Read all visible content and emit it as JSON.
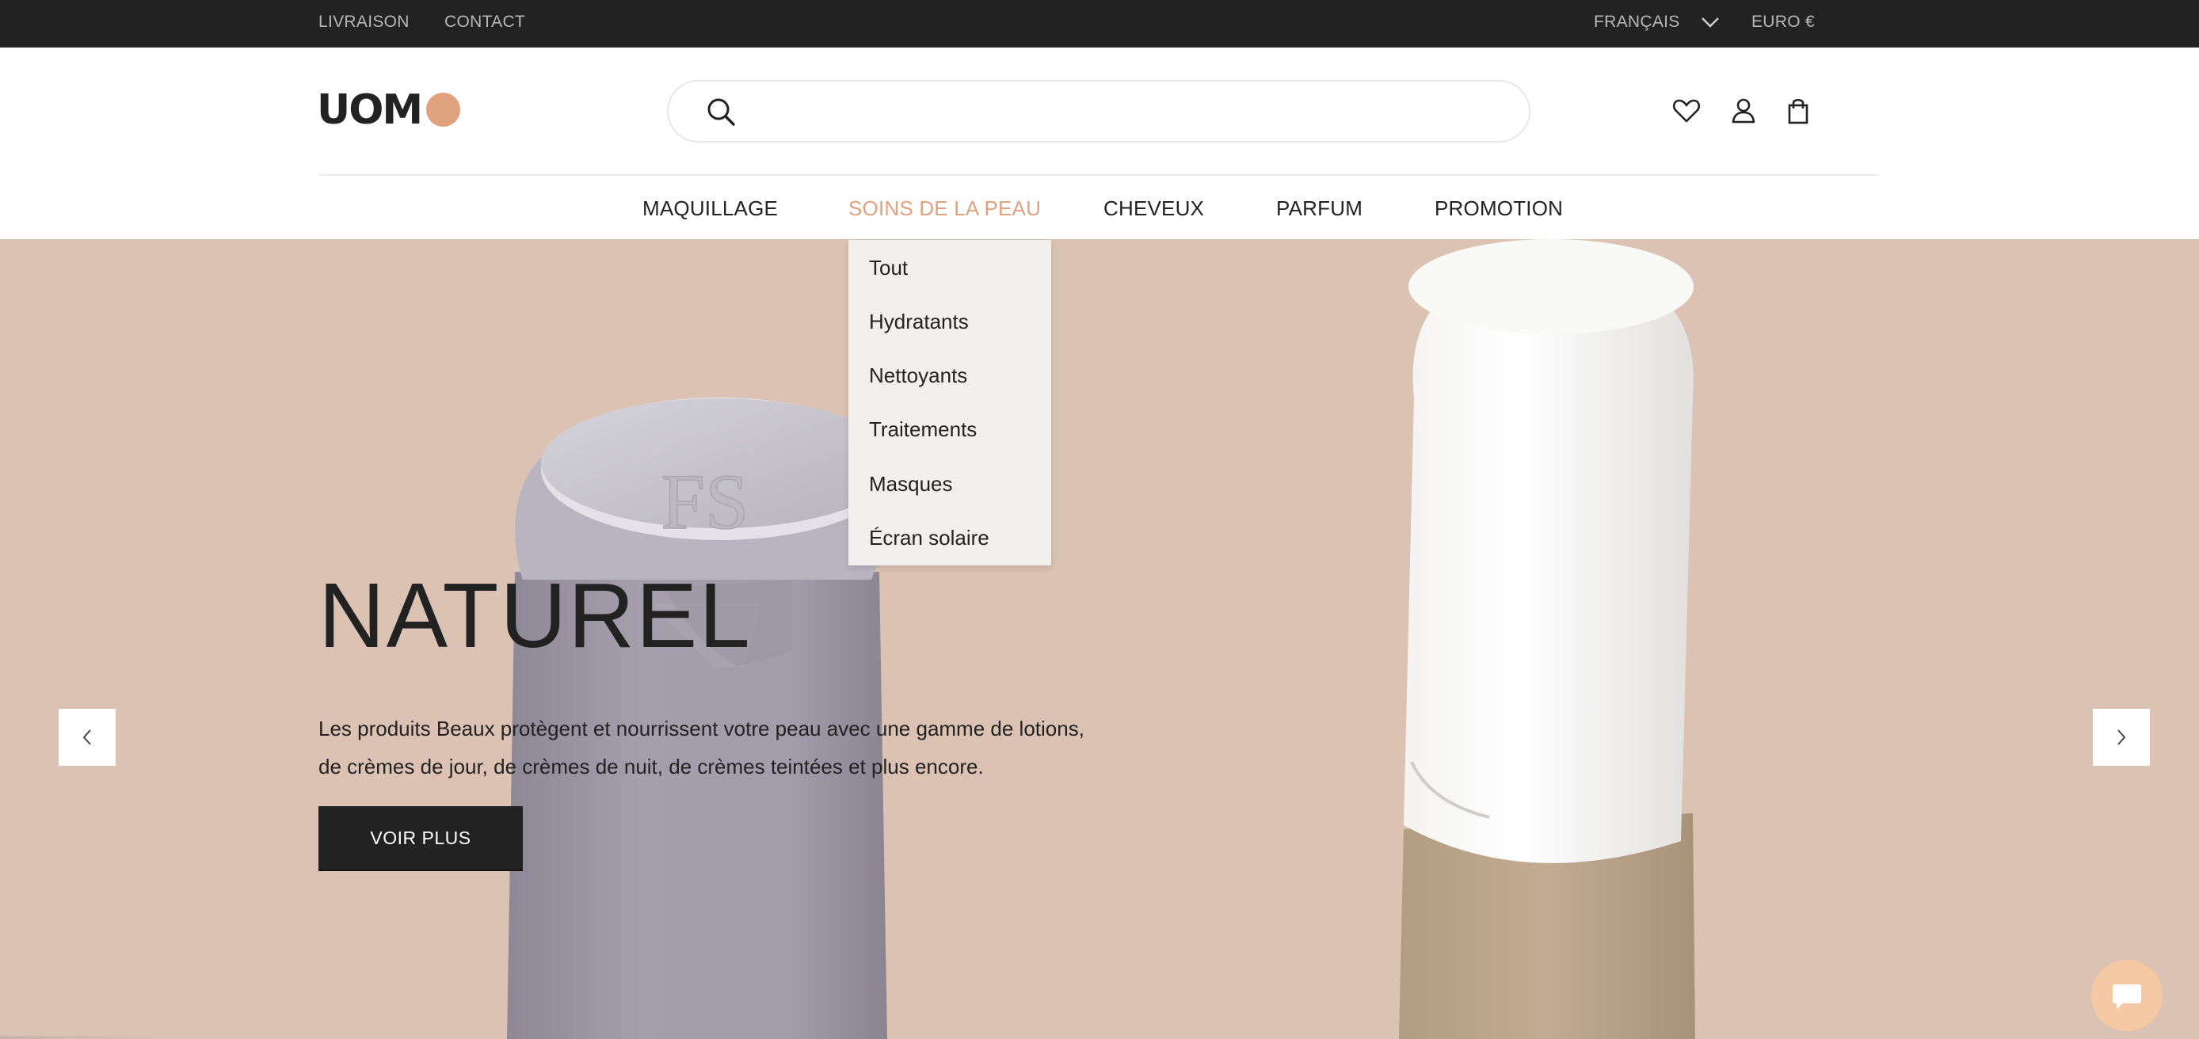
{
  "topbar": {
    "livraison": "LIVRAISON",
    "contact": "CONTACT",
    "language": "FRANÇAIS",
    "currency": "EURO €"
  },
  "header": {
    "logo_text": "UOM",
    "search": {
      "placeholder": "",
      "value": ""
    },
    "icons": [
      "heart-icon",
      "user-icon",
      "shopping-bag-icon",
      "search-icon"
    ]
  },
  "nav": {
    "items": [
      "MAQUILLAGE",
      "SOINS DE LA PEAU",
      "CHEVEUX",
      "PARFUM",
      "PROMOTION"
    ],
    "active_index": 1
  },
  "dropdown": {
    "items": [
      "Tout",
      "Hydratants",
      "Nettoyants",
      "Traitements",
      "Masques",
      "Écran solaire"
    ]
  },
  "hero": {
    "title": "NATUREL",
    "text_line1": "Les produits Beaux protègent et nourrissent votre peau avec une gamme de lotions,",
    "text_line2": "de crèmes de jour, de crèmes de nuit, de crèmes teintées et plus encore.",
    "button_label": "VOIR PLUS",
    "bottle_mark": "FS"
  },
  "colors": {
    "accent": "#e0a17e",
    "topbar_bg": "#222222",
    "hero_bg": "#dbc2b2",
    "dropdown_bg": "#f1f0ef",
    "chat_bg": "#f5c9a4"
  }
}
